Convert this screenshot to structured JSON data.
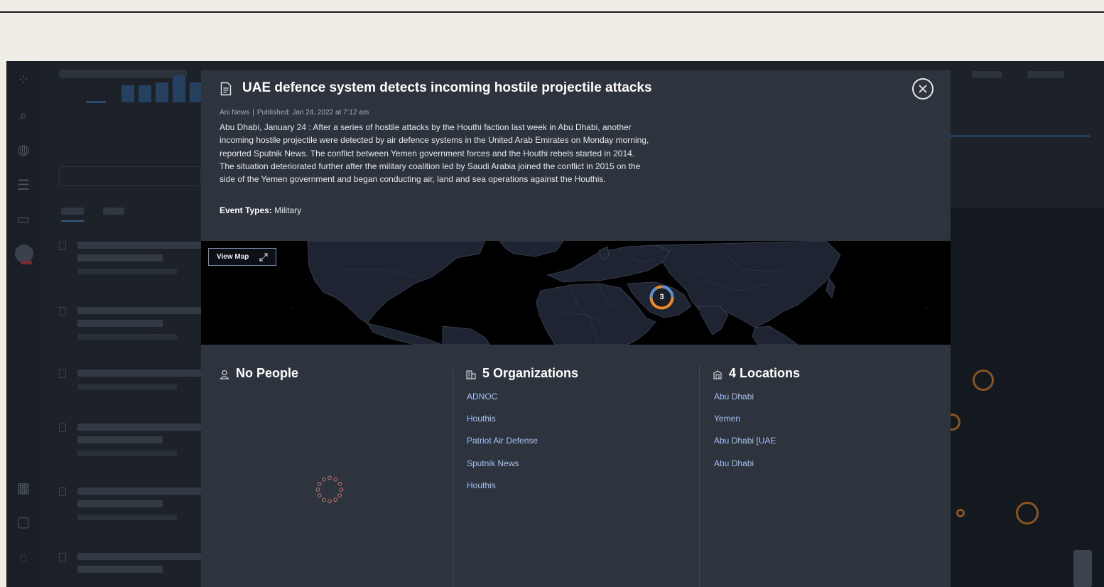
{
  "article": {
    "title": "UAE defence system detects incoming hostile projectile attacks",
    "source": "Ani News",
    "published": "Published: Jan 24, 2022 at 7:12 am",
    "body": "Abu Dhabi, January 24 : After a series of hostile attacks by the Houthi faction last week in Abu Dhabi, another incoming hostile projectile were detected by air defence systems in the United Arab Emirates on Monday morning, reported Sputnik News. The conflict between Yemen government forces and the Houthi rebels started in 2014. The situation deteriorated further after the military coalition led by Saudi Arabia joined the conflict in 2015 on the side of the Yemen government and began conducting air, land and sea operations against the Houthis.",
    "event_types_label": "Event Types:",
    "event_types_value": "Military"
  },
  "map": {
    "view_map_label": "View Map",
    "cluster_count": "3"
  },
  "people": {
    "title": "No People"
  },
  "organizations": {
    "title": "5 Organizations",
    "items": [
      "ADNOC",
      "Houthis",
      "Patriot Air Defense",
      "Sputnik News",
      "Houthis"
    ]
  },
  "locations": {
    "title": "4 Locations",
    "items": [
      "Abu Dhabi",
      "Yemen",
      "Abu Dhabi [UAE",
      "Abu Dhabi"
    ]
  },
  "colors": {
    "modal_bg": "#2e343d",
    "link": "#a4c0f4",
    "cluster_orange": "#f08a24",
    "cluster_blue": "#5b8fd6"
  },
  "icons": [
    "document-icon",
    "close-icon",
    "expand-icon",
    "person-icon",
    "organization-icon",
    "location-icon",
    "loading-spinner"
  ]
}
